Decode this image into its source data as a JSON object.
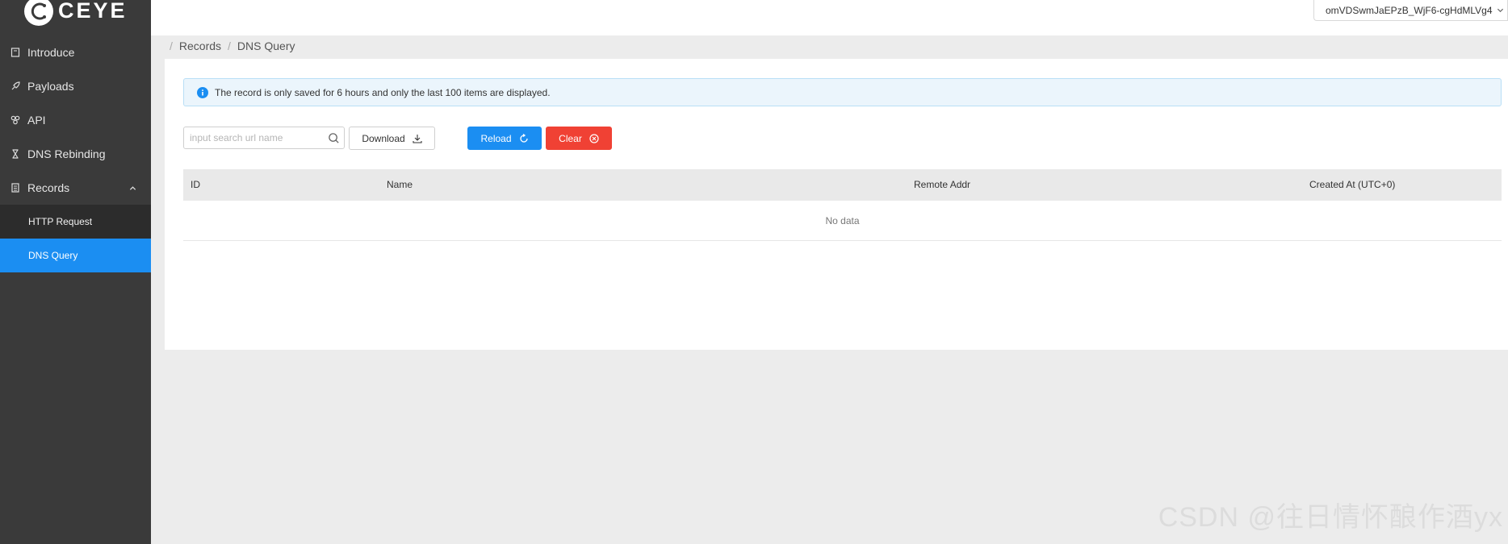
{
  "brand": {
    "name": "CEYE"
  },
  "sidebar": {
    "items": [
      {
        "label": "Introduce",
        "icon": "book-icon"
      },
      {
        "label": "Payloads",
        "icon": "rocket-icon"
      },
      {
        "label": "API",
        "icon": "api-icon"
      },
      {
        "label": "DNS Rebinding",
        "icon": "hourglass-icon"
      },
      {
        "label": "Records",
        "icon": "records-icon"
      }
    ],
    "records_sub": [
      {
        "label": "HTTP Request"
      },
      {
        "label": "DNS Query"
      }
    ]
  },
  "header": {
    "user_token": "omVDSwmJaEPzB_WjF6-cgHdMLVg4"
  },
  "breadcrumb": {
    "items": [
      "Records",
      "DNS Query"
    ]
  },
  "alert": {
    "text": "The record is only saved for 6 hours and only the last 100 items are displayed."
  },
  "toolbar": {
    "search_placeholder": "input search url name",
    "download_label": "Download",
    "reload_label": "Reload",
    "clear_label": "Clear"
  },
  "table": {
    "columns": [
      "ID",
      "Name",
      "Remote Addr",
      "Created At (UTC+0)"
    ],
    "empty_text": "No data"
  },
  "watermark": "CSDN @往日情怀酿作酒yx",
  "colors": {
    "primary": "#1b8ef2",
    "danger": "#f04134",
    "sidebar": "#3a3a3a"
  }
}
